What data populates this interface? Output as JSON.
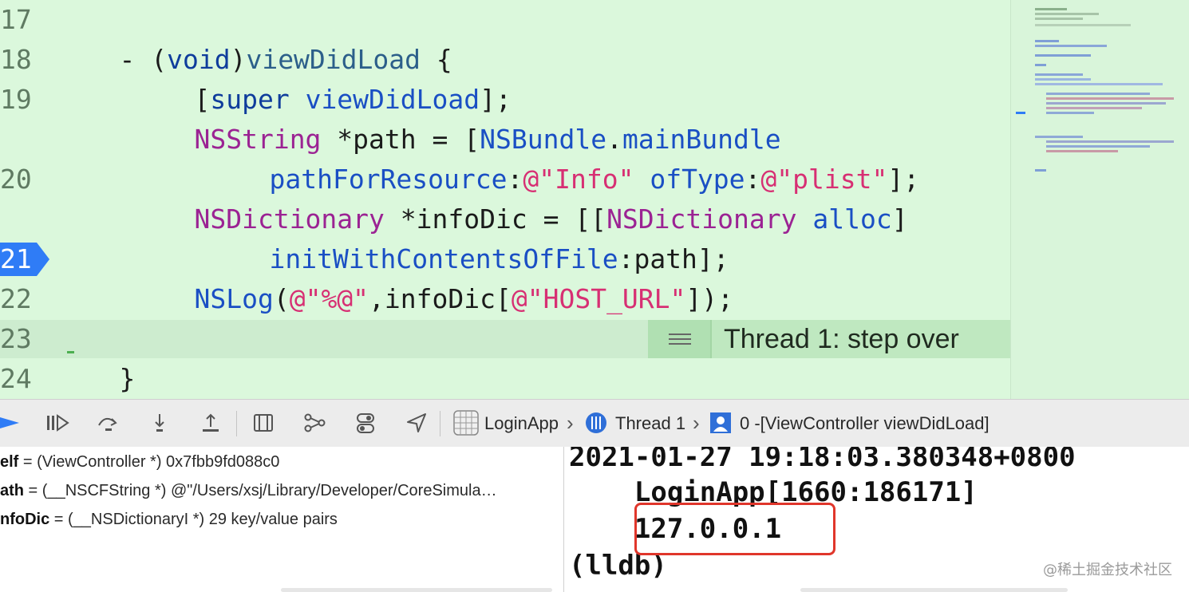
{
  "editor": {
    "line_numbers": [
      "17",
      "18",
      "19",
      "20",
      "21",
      "22",
      "23",
      "24"
    ],
    "code": {
      "l17": {
        "minus": "- (",
        "type": "void",
        "close": ")",
        "name": "viewDidLoad",
        "brace": " {"
      },
      "l18": {
        "open": "[",
        "sup": "super",
        "msg": " viewDidLoad",
        "end": "];"
      },
      "l19a": {
        "cls": "NSString",
        "var": " *path = [",
        "cls2": "NSBundle",
        "dot": ".",
        "meth": "mainBundle"
      },
      "l19b": {
        "meth": "pathForResource",
        "colon": ":",
        "str1": "@\"Info\"",
        "sp": " ",
        "meth2": "ofType",
        "colon2": ":",
        "str2": "@\"plist\"",
        "end": "];"
      },
      "l20a": {
        "cls": "NSDictionary",
        "var": " *infoDic = [[",
        "cls2": "NSDictionary",
        "sp": " ",
        "meth": "alloc",
        "end": "]"
      },
      "l20b": {
        "meth": "initWithContentsOfFile",
        "rest": ":path];"
      },
      "l21": {
        "fn": "NSLog",
        "open": "(",
        "str1": "@\"%@\"",
        "mid": ",infoDic[",
        "str2": "@\"HOST_URL\"",
        "end": "]);"
      },
      "l23": {
        "brace": "}"
      }
    },
    "annotation": "Thread 1: step over"
  },
  "debugbar": {
    "app": "LoginApp",
    "thread": "Thread 1",
    "frame": "0 -[ViewController viewDidLoad]"
  },
  "variables": [
    {
      "name": "elf",
      "value": " = (ViewController *) 0x7fbb9fd088c0"
    },
    {
      "name": "ath",
      "value": " = (__NSCFString *) @\"/Users/xsj/Library/Developer/CoreSimula…"
    },
    {
      "name": "nfoDic",
      "value": " = (__NSDictionaryI *) 29 key/value pairs"
    }
  ],
  "console": {
    "lines": [
      "2021-01-27 19:18:03.380348+0800",
      "    LoginApp[1660:186171]",
      "    127.0.0.1",
      "(lldb)"
    ],
    "watermark": "@稀土掘金技术社区"
  },
  "colors": {
    "editor_bg": "#dbf8dc",
    "breakpoint": "#2f7cf6",
    "highlight": "#e0362b"
  }
}
